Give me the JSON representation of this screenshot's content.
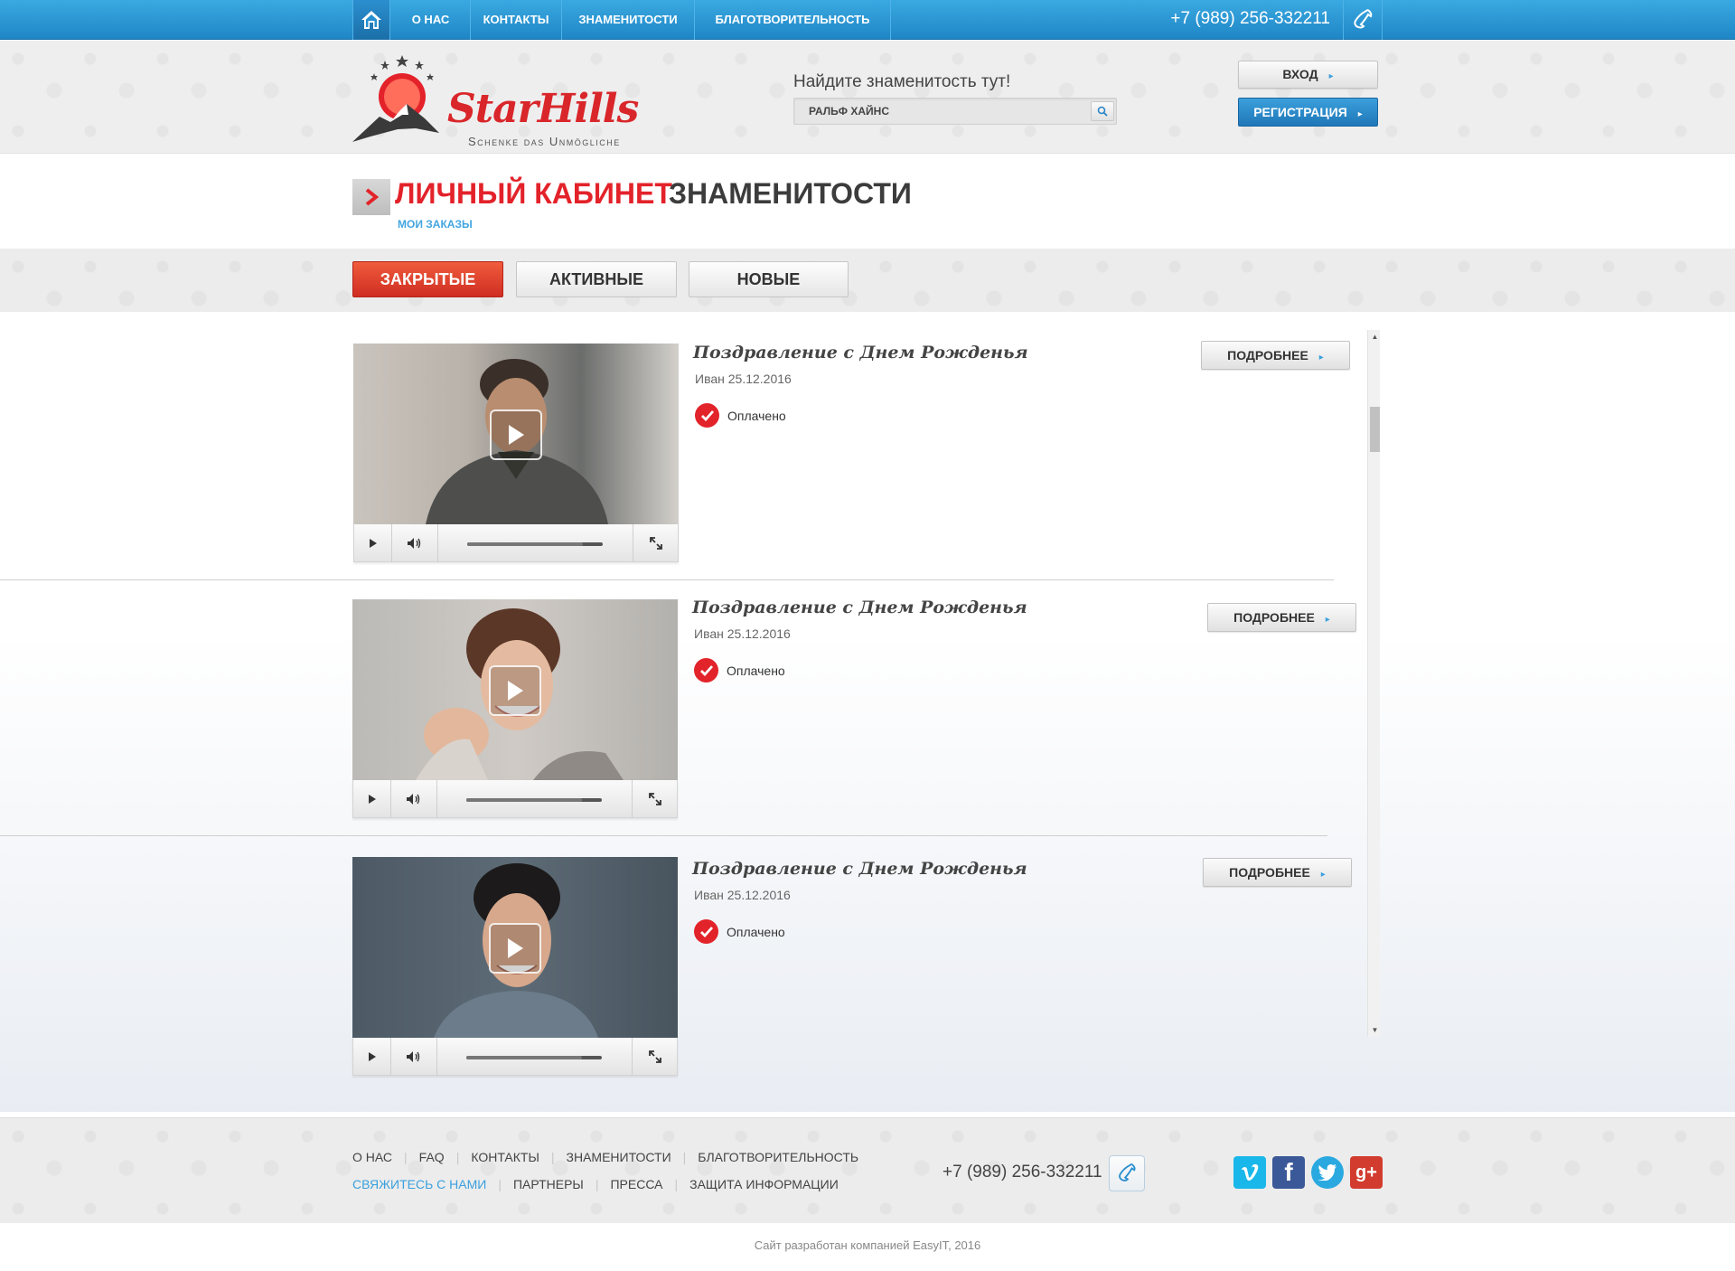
{
  "nav": {
    "items": [
      "О НАС",
      "КОНТАКТЫ",
      "ЗНАМЕНИТОСТИ",
      "БЛАГОТВОРИТЕЛЬНОСТЬ"
    ],
    "phone": "+7 (989) 256-332211"
  },
  "logo": {
    "name": "StarHills",
    "tagline": "Schenke das Unmögliche"
  },
  "search": {
    "label": "Найдите знаменитость тут!",
    "value": "РАЛЬФ ХАЙНС"
  },
  "auth": {
    "login": "ВХОД",
    "register": "РЕГИСТРАЦИЯ"
  },
  "page": {
    "title_red": "ЛИЧНЫЙ КАБИНЕТ",
    "title_dark": "ЗНАМЕНИТОСТИ",
    "subtitle": "МОИ ЗАКАЗЫ"
  },
  "tabs": [
    "ЗАКРЫТЫЕ",
    "АКТИВНЫЕ",
    "НОВЫЕ"
  ],
  "orders": [
    {
      "title": "Поздравление с Днем Рожденья",
      "meta": "Иван 25.12.2016",
      "status": "Оплачено",
      "more": "ПОДРОБНЕЕ"
    },
    {
      "title": "Поздравление с Днем Рожденья",
      "meta": "Иван 25.12.2016",
      "status": "Оплачено",
      "more": "ПОДРОБНЕЕ"
    },
    {
      "title": "Поздравление с Днем Рожденья",
      "meta": "Иван 25.12.2016",
      "status": "Оплачено",
      "more": "ПОДРОБНЕЕ"
    }
  ],
  "footer": {
    "row1": [
      "О НАС",
      "FAQ",
      "КОНТАКТЫ",
      "ЗНАМЕНИТОСТИ",
      "БЛАГОТВОРИТЕЛЬНОСТЬ"
    ],
    "row2": [
      "СВЯЖИТЕСЬ С НАМИ",
      "ПАРТНЕРЫ",
      "ПРЕССА",
      "ЗАЩИТА ИНФОРМАЦИИ"
    ],
    "phone": "+7 (989) 256-332211",
    "social": [
      "vimeo-icon",
      "facebook-icon",
      "twitter-icon",
      "google-plus-icon"
    ],
    "copyright": "Сайт разработан компанией EasyIT, 2016"
  },
  "colors": {
    "accent_blue": "#2390d0",
    "accent_red": "#e3222a"
  }
}
